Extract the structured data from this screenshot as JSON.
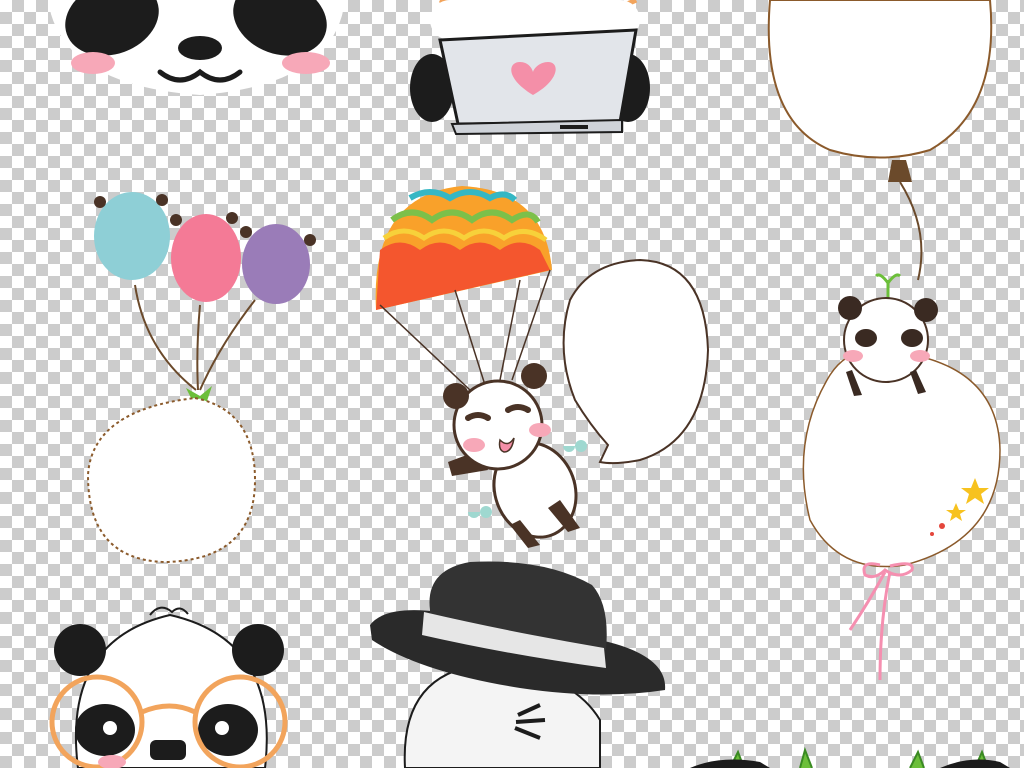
{
  "canvas": {
    "checker_light": "#ffffff",
    "checker_dark": "#cccccc"
  },
  "colors": {
    "panda_black": "#1c1c1c",
    "panda_white": "#ffffff",
    "blush": "#f7a8b8",
    "heart": "#f48fa8",
    "laptop": "#e2e5ea",
    "balloon_blue": "#8ecfd6",
    "balloon_pink": "#f47a96",
    "balloon_purple": "#9a7cb8",
    "parachute_red": "#f4562e",
    "parachute_orange": "#f9a12a",
    "parachute_yellow": "#f7d13a",
    "parachute_green": "#7cc04a",
    "parachute_teal": "#35b7c4",
    "glasses_orange": "#f2a45c",
    "hat_black": "#2a2a2a",
    "hat_band": "#e6e6e6",
    "ribbon_pink": "#f58fb0",
    "star_yellow": "#f7c21f",
    "star_red": "#e4463c",
    "bow_green": "#6cbf3a",
    "mint_flower": "#9fd8d0",
    "outline_brown": "#8b5a2b"
  },
  "elements": [
    {
      "name": "panda-face-top-left",
      "icon": "panda-face-icon"
    },
    {
      "name": "panda-with-laptop",
      "icon": "laptop-heart-icon"
    },
    {
      "name": "speech-balloon-top-right",
      "icon": "balloon-icon"
    },
    {
      "name": "balloon-bunch-frame",
      "icon": "balloons-icon"
    },
    {
      "name": "parachute-panda",
      "icon": "parachute-icon"
    },
    {
      "name": "speech-bubble-middle",
      "icon": "speech-bubble-icon"
    },
    {
      "name": "panda-on-balloon",
      "icon": "panda-balloon-icon"
    },
    {
      "name": "panda-with-glasses",
      "icon": "glasses-icon"
    },
    {
      "name": "panda-with-fedora",
      "icon": "fedora-hat-icon"
    }
  ]
}
